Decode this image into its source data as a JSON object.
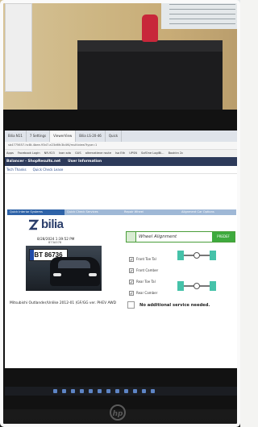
{
  "browser": {
    "tabs": [
      "Bilia N11",
      "7 Settings",
      "ViewerView",
      "Bilia LS-20-46",
      "Quick"
    ],
    "active_tab_index": 2,
    "url": "sb4775657-hc8t-4bee-93d7-e23d6fc3b4f4/multiview?type=1",
    "bookmarks": [
      "Apps",
      "Facebook Login",
      "NR-923",
      "Ivan sda",
      "GUS",
      "alternatieve route",
      "Isa Eth",
      "UPSN",
      "SofOne LogiBi...",
      "Bookkn 2c"
    ]
  },
  "app": {
    "nav": [
      "Balancer - ShopResults.net",
      "User Information"
    ],
    "subnav": [
      "Tech Thanks",
      "Quick Check Lease"
    ],
    "steps": [
      "Quick Interior Systems",
      "Quick Check Services",
      "Repair Wheel",
      "Alignment Car Options"
    ],
    "active_step_index": 0,
    "logo_text": "bilia",
    "datetime": "8/28/2024 1:39:52 PM",
    "vehicle_id": "873A578",
    "plate": "BT 86736",
    "wheel_alignment": {
      "label": "Wheel Alignment",
      "button": "PREDEF"
    },
    "checklist": [
      "Front Toe Tal",
      "Front Camber",
      "Rear Toe Tal",
      "Rear Camber"
    ],
    "vehicle_name": "Mitsubishi Outlander/Unlike 2012-01 (GF/GG ver. PHEV AWD",
    "no_additional_label": "No additional service needed.",
    "colors": {
      "nav": "#2d3a5a",
      "step_active": "#2e63a8",
      "accent_green": "#3eaa3e",
      "wheel": "#45c2a9"
    }
  },
  "monitor": {
    "brand": "hp"
  }
}
